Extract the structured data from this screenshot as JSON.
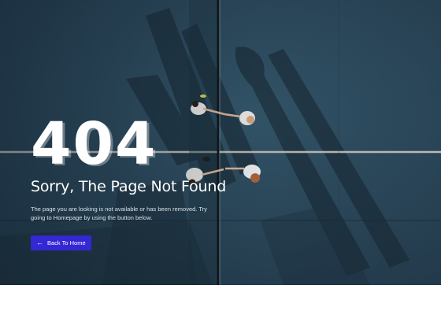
{
  "error": {
    "code": "404",
    "title": "Sorry, The Page Not Found",
    "description": "The page you are looking is not available or has been removed. Try going to Homepage by using the button below.",
    "button_label": "Back To Home",
    "button_icon": "arrow-left-icon"
  },
  "colors": {
    "court": "#2c4a5b",
    "button": "#3427d4",
    "text": "#ffffff"
  }
}
